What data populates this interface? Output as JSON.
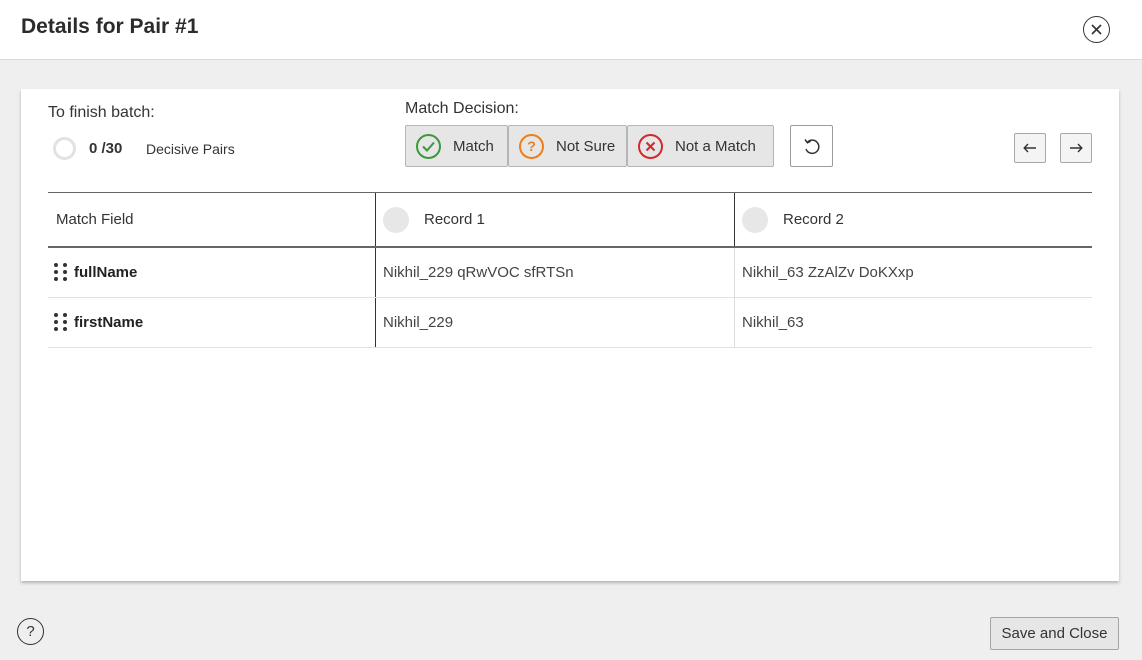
{
  "dialog": {
    "title": "Details for Pair #1"
  },
  "batch": {
    "title": "To finish batch:",
    "progress": "0 /30",
    "progress_label": "Decisive Pairs",
    "completed": 0,
    "total": 30
  },
  "decision": {
    "title": "Match Decision:",
    "match_label": "Match",
    "not_sure_label": "Not Sure",
    "not_match_label": "Not a Match",
    "colors": {
      "match": "#3a9a3a",
      "not_sure": "#ef7d1a",
      "not_match": "#d7262c"
    }
  },
  "table": {
    "headers": [
      "Match Field",
      "Record 1",
      "Record 2"
    ],
    "rows": [
      {
        "field": "fullName",
        "record1": "Nikhil_229 qRwVOC sfRTSn",
        "record2": "Nikhil_63 ZzAlZv DoKXxp"
      },
      {
        "field": "firstName",
        "record1": "Nikhil_229",
        "record2": "Nikhil_63"
      }
    ]
  },
  "icons": [
    "close-icon",
    "check-circle-icon",
    "question-circle-icon",
    "x-circle-icon",
    "undo-icon",
    "arrow-left-icon",
    "arrow-right-icon",
    "drag-handle-icon",
    "help-icon"
  ],
  "footer": {
    "help": "?",
    "save_close": "Save and Close"
  }
}
